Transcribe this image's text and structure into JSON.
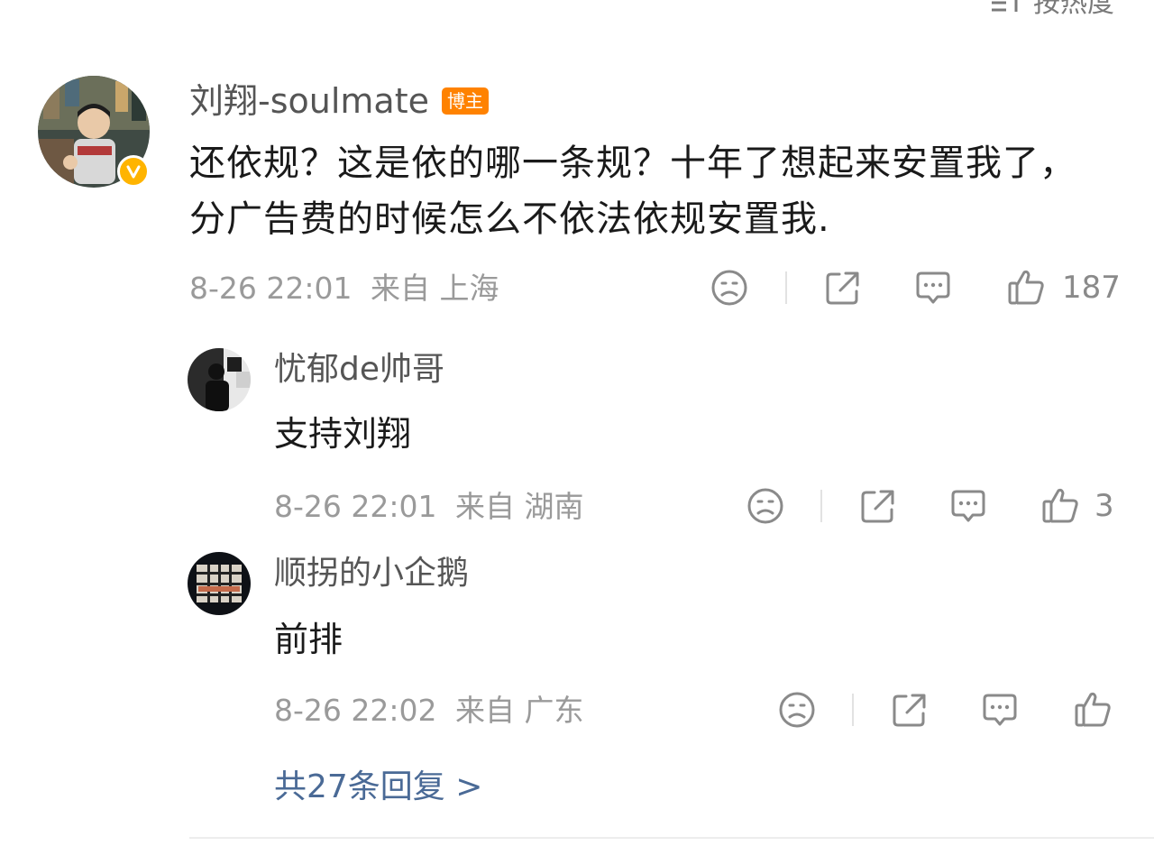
{
  "sort": {
    "label": "按热度"
  },
  "main_comment": {
    "author": "刘翔-soulmate",
    "badge": "博主",
    "text": "还依规？这是依的哪一条规？十年了想起来安置我了，分广告费的时候怎么不依法依规安置我.",
    "time": "8-26 22:01",
    "location": "来自 上海",
    "likes": "187"
  },
  "replies": [
    {
      "author": "忧郁de帅哥",
      "text": "支持刘翔",
      "time": "8-26 22:01",
      "location": "来自 湖南",
      "likes": "3"
    },
    {
      "author": "顺拐的小企鹅",
      "text": "前排",
      "time": "8-26 22:02",
      "location": "来自 广东",
      "likes": ""
    }
  ],
  "more_replies": {
    "label": "共27条回复 >"
  },
  "icons": [
    "sort-icon",
    "verified-icon",
    "dislike-icon",
    "share-icon",
    "comment-icon",
    "like-icon"
  ],
  "colors": {
    "badge": "#ff8200",
    "verified": "#ffb400",
    "link": "#4a6a96",
    "meta": "#9a9a9a"
  }
}
